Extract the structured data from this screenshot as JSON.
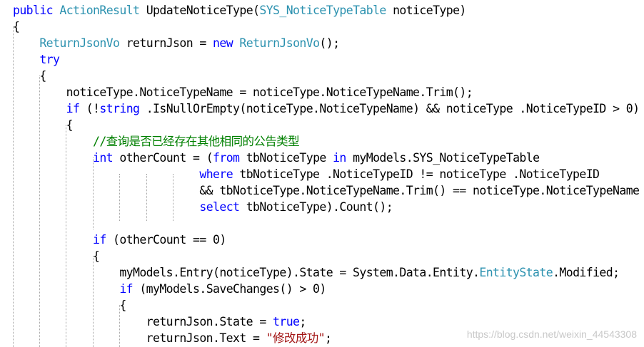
{
  "colors": {
    "keyword": "#0000ff",
    "type": "#2b91af",
    "comment": "#008000",
    "string": "#a31515",
    "plain": "#000000",
    "guide": "#a6a6a6"
  },
  "code_lines": [
    [
      [
        "kw",
        "public"
      ],
      [
        "p",
        " "
      ],
      [
        "ty",
        "ActionResult"
      ],
      [
        "p",
        " UpdateNoticeType("
      ],
      [
        "ty",
        "SYS_NoticeTypeTable"
      ],
      [
        "p",
        " noticeType)"
      ]
    ],
    [
      [
        "p",
        "{"
      ]
    ],
    [
      [
        "p",
        "    "
      ],
      [
        "ty",
        "ReturnJsonVo"
      ],
      [
        "p",
        " returnJson = "
      ],
      [
        "kw",
        "new"
      ],
      [
        "p",
        " "
      ],
      [
        "ty",
        "ReturnJsonVo"
      ],
      [
        "p",
        "();"
      ]
    ],
    [
      [
        "p",
        "    "
      ],
      [
        "kw",
        "try"
      ]
    ],
    [
      [
        "p",
        "    {"
      ]
    ],
    [
      [
        "p",
        "        noticeType.NoticeTypeName = noticeType.NoticeTypeName.Trim();"
      ]
    ],
    [
      [
        "p",
        "        "
      ],
      [
        "kw",
        "if"
      ],
      [
        "p",
        " (!"
      ],
      [
        "kw",
        "string"
      ],
      [
        "p",
        " .IsNullOrEmpty(noticeType.NoticeTypeName) && noticeType .NoticeTypeID > 0)"
      ]
    ],
    [
      [
        "p",
        "        {"
      ]
    ],
    [
      [
        "p",
        "            "
      ],
      [
        "cm",
        "//查询是否已经存在其他相同的公告类型"
      ]
    ],
    [
      [
        "p",
        "            "
      ],
      [
        "kw",
        "int"
      ],
      [
        "p",
        " otherCount = ("
      ],
      [
        "kw",
        "from"
      ],
      [
        "p",
        " tbNoticeType "
      ],
      [
        "kw",
        "in"
      ],
      [
        "p",
        " myModels.SYS_NoticeTypeTable"
      ]
    ],
    [
      [
        "p",
        "                            "
      ],
      [
        "kw",
        "where"
      ],
      [
        "p",
        " tbNoticeType .NoticeTypeID != noticeType .NoticeTypeID"
      ]
    ],
    [
      [
        "p",
        "                            && tbNoticeType.NoticeTypeName.Trim() == noticeType.NoticeTypeName"
      ]
    ],
    [
      [
        "p",
        "                            "
      ],
      [
        "kw",
        "select"
      ],
      [
        "p",
        " tbNoticeType).Count();"
      ]
    ],
    [
      [
        "p",
        ""
      ]
    ],
    [
      [
        "p",
        "            "
      ],
      [
        "kw",
        "if"
      ],
      [
        "p",
        " (otherCount == 0)"
      ]
    ],
    [
      [
        "p",
        "            {"
      ]
    ],
    [
      [
        "p",
        "                myModels.Entry(noticeType).State = System.Data.Entity."
      ],
      [
        "ty",
        "EntityState"
      ],
      [
        "p",
        ".Modified;"
      ]
    ],
    [
      [
        "p",
        "                "
      ],
      [
        "kw",
        "if"
      ],
      [
        "p",
        " (myModels.SaveChanges() > 0)"
      ]
    ],
    [
      [
        "p",
        "                {"
      ]
    ],
    [
      [
        "p",
        "                    returnJson.State = "
      ],
      [
        "kw",
        "true"
      ],
      [
        "p",
        ";"
      ]
    ],
    [
      [
        "p",
        "                    returnJson.Text = "
      ],
      [
        "st",
        "\"修改成功\""
      ],
      [
        "p",
        ";"
      ]
    ]
  ],
  "watermark": "https://blog.csdn.net/weixin_44543308"
}
